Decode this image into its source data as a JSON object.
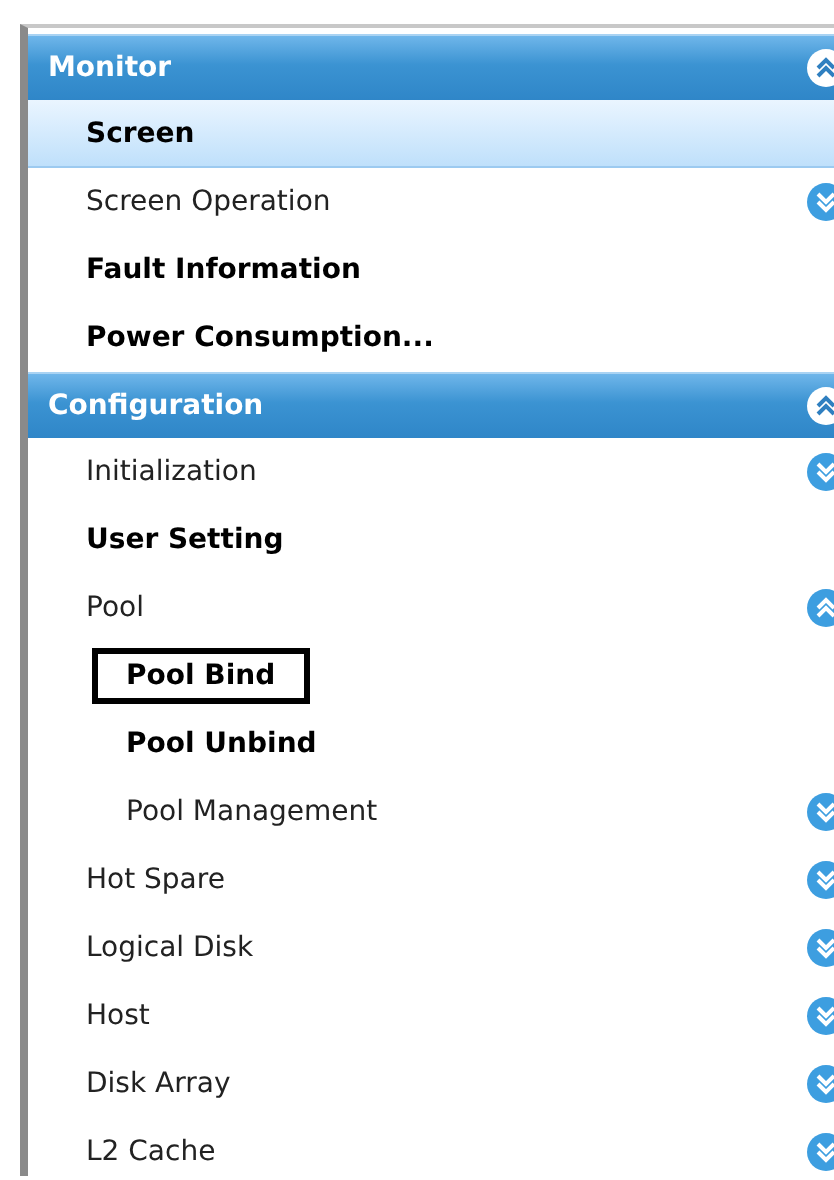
{
  "sections": [
    {
      "title": "Monitor",
      "expanded": true,
      "items": [
        {
          "kind": "page",
          "label": "Screen",
          "selected": true,
          "focused": false
        },
        {
          "kind": "group",
          "label": "Screen Operation",
          "selected": false,
          "focused": false,
          "expanded": false
        },
        {
          "kind": "page",
          "label": "Fault Information",
          "selected": false,
          "focused": false
        },
        {
          "kind": "page",
          "label": "Power Consumption...",
          "selected": false,
          "focused": false
        }
      ]
    },
    {
      "title": "Configuration",
      "expanded": true,
      "items": [
        {
          "kind": "group",
          "label": "Initialization",
          "selected": false,
          "focused": false,
          "expanded": false
        },
        {
          "kind": "page",
          "label": "User Setting",
          "selected": false,
          "focused": false
        },
        {
          "kind": "group",
          "label": "Pool",
          "selected": false,
          "focused": false,
          "expanded": true,
          "children": [
            {
              "kind": "page",
              "label": "Pool Bind",
              "selected": false,
              "focused": true
            },
            {
              "kind": "page",
              "label": "Pool Unbind",
              "selected": false,
              "focused": false
            },
            {
              "kind": "group",
              "label": "Pool Management",
              "selected": false,
              "focused": false,
              "expanded": false
            }
          ]
        },
        {
          "kind": "group",
          "label": "Hot Spare",
          "selected": false,
          "focused": false,
          "expanded": false
        },
        {
          "kind": "group",
          "label": "Logical Disk",
          "selected": false,
          "focused": false,
          "expanded": false
        },
        {
          "kind": "group",
          "label": "Host",
          "selected": false,
          "focused": false,
          "expanded": false
        },
        {
          "kind": "group",
          "label": "Disk Array",
          "selected": false,
          "focused": false,
          "expanded": false
        },
        {
          "kind": "group",
          "label": "L2 Cache",
          "selected": false,
          "focused": false,
          "expanded": false
        }
      ]
    }
  ]
}
